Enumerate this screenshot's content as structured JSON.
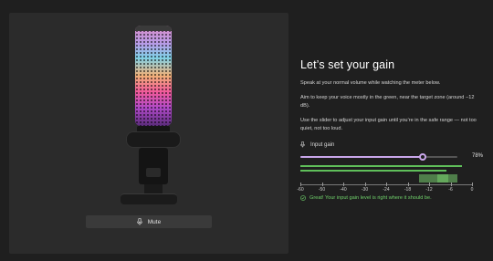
{
  "mute_button": {
    "label": "Mute"
  },
  "main": {
    "title": "Let’s set your gain",
    "paragraphs": [
      "Speak at your normal volume while watching the meter below.",
      "Aim to keep your voice mostly in the green, near the target zone (around −12 dB).",
      "Use the slider to adjust your input gain until you’re in the safe range — not too quiet, not too loud."
    ],
    "gain_label": "Input gain",
    "gain_value": 0.78,
    "gain_value_text": "78%",
    "meter": {
      "ticks": [
        "-60",
        "-50",
        "-40",
        "-30",
        "-24",
        "-18",
        "-12",
        "-6",
        "0"
      ],
      "level_top": 0.94,
      "level_bottom": 0.85
    },
    "status": "Great! Your input gain level is right where it should be."
  },
  "colors": {
    "accent": "#c9a6ea",
    "meter_green": "#5fbf5a",
    "status_green": "#6fd06a"
  }
}
